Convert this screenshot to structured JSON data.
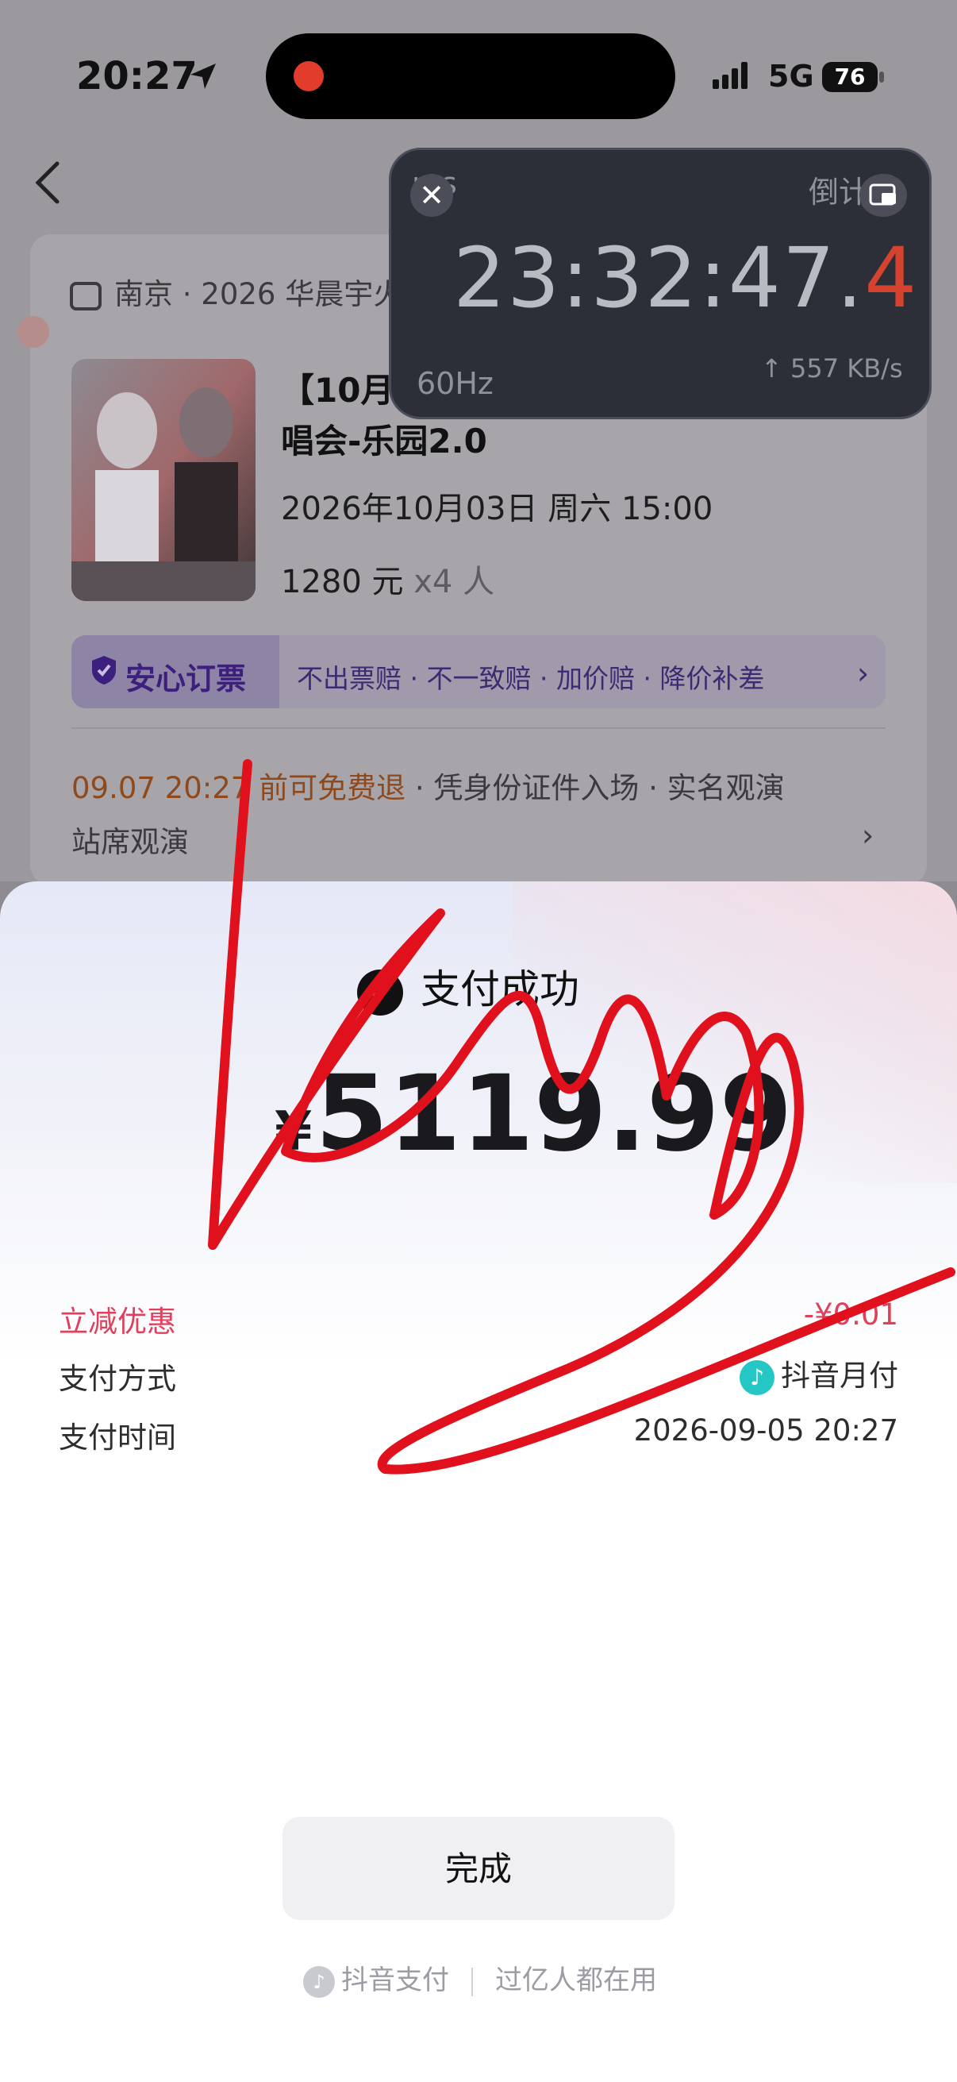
{
  "status_bar": {
    "time": "20:27",
    "network": "5G",
    "battery": "76"
  },
  "event": {
    "venue": "南京 · 2026 华晨宇火",
    "title_line1": "【10月",
    "title_line2": "唱会-乐园2.0",
    "datetime": "2026年10月03日 周六 15:00",
    "price": "1280 元",
    "count": "x4 人",
    "assurance_title": "安心订票",
    "assurance_text": "不出票赔 · 不一致赔 · 加价赔 · 降价补差",
    "refund_deadline": "09.07 20:27 前可免费退",
    "refund_rest": " · 凭身份证件入场 · 实名观演",
    "seat_type": "站席观演"
  },
  "timer": {
    "ms_label": "ms",
    "countdown_label": "倒计时",
    "clock_main": "23:32:47.",
    "clock_tenth": "4",
    "refresh": "60Hz",
    "speed": "↑ 557 KB/s"
  },
  "payment": {
    "status": "支付成功",
    "currency": "¥",
    "amount": "5119.99",
    "discount_label": "立减优惠",
    "discount_value": "-¥0.01",
    "method_label": "支付方式",
    "method_value": "抖音月付",
    "time_label": "支付时间",
    "time_value": "2026-09-05 20:27",
    "done_button": "完成",
    "footer_brand": "抖音支付",
    "footer_slogan": "过亿人都在用"
  },
  "colors": {
    "accent_red": "#e0405c",
    "scribble": "#e0101c",
    "timer_red": "#d5432e",
    "douyin_teal": "#25c7c4"
  }
}
